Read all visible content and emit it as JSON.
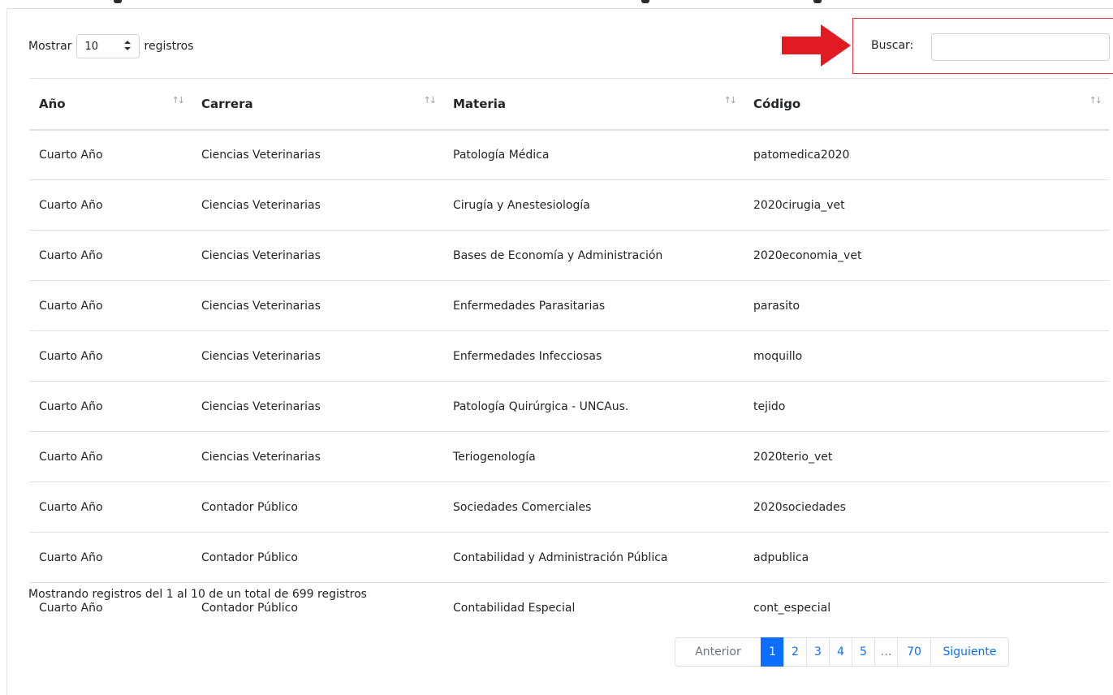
{
  "length_control": {
    "prefix": "Mostrar",
    "selected": "10",
    "suffix": "registros"
  },
  "search": {
    "label": "Buscar:",
    "value": "",
    "placeholder": ""
  },
  "table": {
    "headers": [
      "Año",
      "Carrera",
      "Materia",
      "Código"
    ],
    "sort_glyph": "↑↓",
    "rows": [
      [
        "Cuarto Año",
        "Ciencias Veterinarias",
        "Patología Médica",
        "patomedica2020"
      ],
      [
        "Cuarto Año",
        "Ciencias Veterinarias",
        "Cirugía y Anestesiología",
        "2020cirugia_vet"
      ],
      [
        "Cuarto Año",
        "Ciencias Veterinarias",
        "Bases de Economía y Administración",
        "2020economia_vet"
      ],
      [
        "Cuarto Año",
        "Ciencias Veterinarias",
        "Enfermedades Parasitarias",
        "parasito"
      ],
      [
        "Cuarto Año",
        "Ciencias Veterinarias",
        "Enfermedades Infecciosas",
        "moquillo"
      ],
      [
        "Cuarto Año",
        "Ciencias Veterinarias",
        "Patología Quirúrgica - UNCAus.",
        "tejido"
      ],
      [
        "Cuarto Año",
        "Ciencias Veterinarias",
        "Teriogenología",
        "2020terio_vet"
      ],
      [
        "Cuarto Año",
        "Contador Público",
        "Sociedades Comerciales",
        "2020sociedades"
      ],
      [
        "Cuarto Año",
        "Contador Público",
        "Contabilidad y Administración Pública",
        "adpublica"
      ],
      [
        "Cuarto Año",
        "Contador Público",
        "Contabilidad Especial",
        "cont_especial"
      ]
    ]
  },
  "info_text": "Mostrando registros del 1 al 10 de un total de 699 registros",
  "pagination": {
    "previous": "Anterior",
    "pages": [
      "1",
      "2",
      "3",
      "4",
      "5",
      "…",
      "70"
    ],
    "active": "1",
    "next": "Siguiente"
  },
  "colors": {
    "accent": "#0d6efd",
    "highlight_red": "#e0313b",
    "border": "#dee2e6"
  },
  "icons": {
    "arrow": "red-right-arrow-icon",
    "sort": "sort-arrows-icon",
    "select_caret": "updown-caret-icon"
  }
}
